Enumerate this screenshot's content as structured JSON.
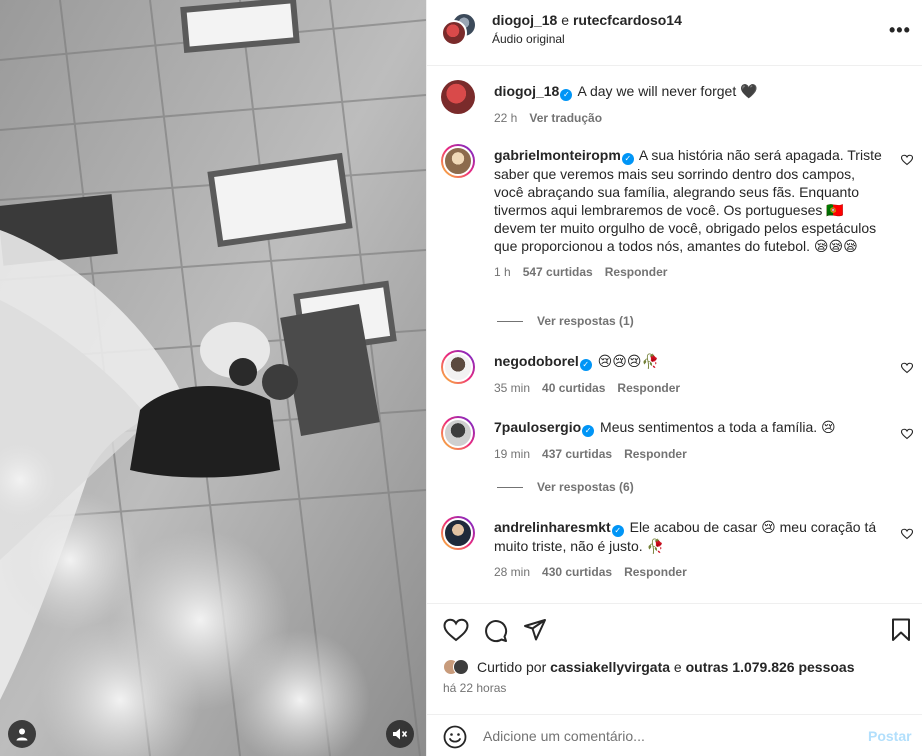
{
  "header": {
    "user1": "diogoj_18",
    "connector": "e",
    "user2": "rutecfcardoso14",
    "audio": "Áudio original",
    "more_label": "•••"
  },
  "caption": {
    "username": "diogoj_18",
    "text": "A day we will never forget 🖤",
    "time": "22 h",
    "translate": "Ver tradução"
  },
  "comments": [
    {
      "username": "gabrielmonteiropm",
      "verified": true,
      "text": "A sua história não será apagada. Triste saber que veremos mais seu sorrindo dentro dos campos, você abraçando sua família, alegrando seus fãs. Enquanto tivermos aqui lembraremos de você. Os portugueses 🇵🇹 devem ter muito orgulho de você, obrigado pelos espetáculos que proporcionou a todos nós, amantes do futebol. 😪😪😪",
      "time": "1 h",
      "likes": "547 curtidas",
      "reply": "Responder",
      "view_replies": "Ver respostas (1)"
    },
    {
      "username": "negodoborel",
      "verified": true,
      "text": "😢😢😢🥀",
      "time": "35 min",
      "likes": "40 curtidas",
      "reply": "Responder"
    },
    {
      "username": "7paulosergio",
      "verified": true,
      "text": "Meus sentimentos a toda a família. 😢",
      "time": "19 min",
      "likes": "437 curtidas",
      "reply": "Responder",
      "view_replies": "Ver respostas (6)"
    },
    {
      "username": "andrelinharesmkt",
      "verified": true,
      "text": "Ele acabou de casar 😢 meu coração tá muito triste, não é justo. 🥀",
      "time": "28 min",
      "likes": "430 curtidas",
      "reply": "Responder"
    }
  ],
  "footer": {
    "liked_by_prefix": "Curtido por",
    "liked_by_user": "cassiakellyvirgata",
    "liked_by_and": "e",
    "liked_by_others": "outras 1.079.826 pessoas",
    "time": "há 22 horas",
    "comment_placeholder": "Adicione um comentário...",
    "post_label": "Postar"
  },
  "icons": {
    "like": "heart-icon",
    "comment": "comment-icon",
    "share": "share-icon",
    "save": "bookmark-icon",
    "emoji": "smile-icon",
    "tag": "user-tag-icon",
    "mute": "muted-speaker-icon",
    "more": "more-icon"
  },
  "colors": {
    "verified": "#0095f6",
    "muted_text": "#737373",
    "post_disabled": "#b2dffc",
    "border": "#efefef"
  }
}
